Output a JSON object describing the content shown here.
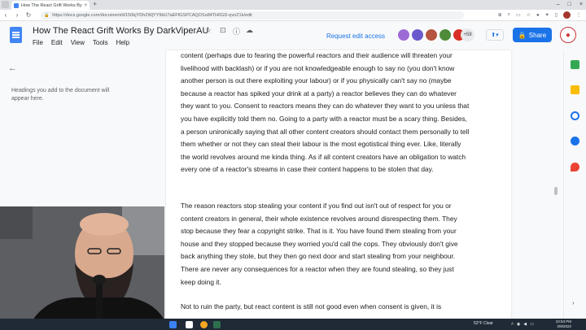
{
  "browser": {
    "tab_title": "How The React Grift Works By Da",
    "tab_close": "×",
    "new_tab": "+",
    "url": "https://docs.google.com/document/d/150bjYDhZWjYY9bU7aEFfGSPCAQOSu84TH0GD-qvnZ1k/edit",
    "window_controls": [
      "–",
      "□",
      "×"
    ]
  },
  "docs": {
    "title": "How The React Grift Works By DarkViperAU",
    "menu": [
      "File",
      "Edit",
      "View",
      "Tools",
      "Help"
    ],
    "request_edit": "Request edit access",
    "avatar_count": "+59",
    "share_label": "Share",
    "outline_hint": "Headings you add to the document will appear here."
  },
  "document": {
    "paragraphs": [
      "content (perhaps due to fearing the powerful reactors and their audience will threaten your livelihood with backlash) or if you are not knowledgeable enough to say no (you don't know another person is out there exploiting your labour) or if you physically can't say no (maybe because a reactor has spiked your drink at a party) a reactor believes they can do whatever they want to you. Consent to reactors means they can do whatever they want to you unless that you have explicitly told them no. Going to a party with a reactor must be a scary thing. Besides, a person unironically saying that all other content creators should contact them personally to tell them whether or not they can steal their labour is the most egotistical thing ever. Like, literally the world revolves around me kinda thing. As if all content creators have an obligation to watch every one of a reactor's streams in case their content happens to be stolen that day.",
      "The reason reactors stop stealing your content if you find out isn't out of respect for you or content creators in general, their whole existence revolves around disrespecting them. They stop because they fear a copyright strike. That is it. You have found them stealing from your house and they stopped because they worried you'd call the cops. They obviously don't give back anything they stole, but they then go next door and start stealing from your neighbour. There are never any consequences for a reactor when they are found stealing, so they just keep doing it.",
      "Not to ruin the party, but react content is still not good even when consent is given, it is"
    ]
  },
  "taskbar": {
    "weather": "52°F  Clear",
    "time": "10:53 PM",
    "date": "2/8/2022"
  },
  "colors": {
    "share": "#1a73e8",
    "docs_blue": "#4285f4"
  }
}
